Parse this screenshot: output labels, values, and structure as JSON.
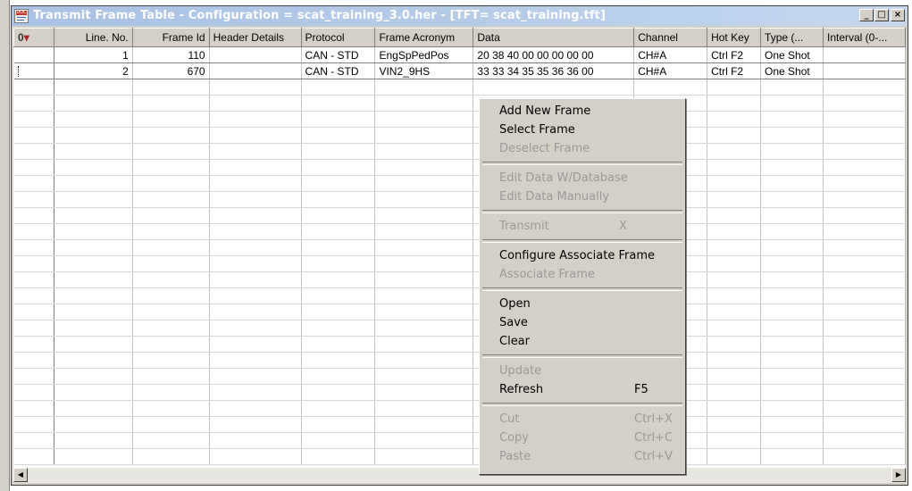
{
  "window": {
    "title": "Transmit Frame Table - Configuration = scat_training_3.0.her - [TFT= scat_training.tft]",
    "icon_label": "DOC",
    "controls": {
      "minimize": "_",
      "maximize": "□",
      "close": "×"
    }
  },
  "table": {
    "columns": [
      "Line. No.",
      "Frame Id",
      "Header Details",
      "Protocol",
      "Frame Acronym",
      "Data",
      "Channel",
      "Hot Key",
      "Type (...",
      "Interval (0-..."
    ],
    "header_icons": {
      "left": "0",
      "right": "▾"
    },
    "rows": [
      {
        "line": "1",
        "frame_id": "110",
        "header": "",
        "protocol": "CAN - STD",
        "acronym": "EngSpPedPos",
        "data": "20 38 40 00 00 00 00 00",
        "channel": "CH#A",
        "hotkey": "Ctrl F2",
        "type": "One Shot",
        "interval": ""
      },
      {
        "line": "2",
        "frame_id": "670",
        "header": "",
        "protocol": "CAN - STD",
        "acronym": "VIN2_9HS",
        "data": "33 33 34 35 35 36 36 00",
        "channel": "CH#A",
        "hotkey": "Ctrl F2",
        "type": "One Shot",
        "interval": ""
      }
    ]
  },
  "context_menu": {
    "add_new_frame": "Add New Frame",
    "select_frame": "Select Frame",
    "deselect_frame": "Deselect Frame",
    "edit_data_db": "Edit Data W/Database",
    "edit_data_manual": "Edit Data Manually",
    "transmit": "Transmit",
    "transmit_shortcut": "X",
    "configure_associate": "Configure Associate Frame",
    "associate_frame": "Associate Frame",
    "open": "Open",
    "save": "Save",
    "clear": "Clear",
    "update": "Update",
    "refresh": "Refresh",
    "refresh_shortcut": "F5",
    "cut": "Cut",
    "cut_shortcut": "Ctrl+X",
    "copy": "Copy",
    "copy_shortcut": "Ctrl+C",
    "paste": "Paste",
    "paste_shortcut": "Ctrl+V"
  },
  "scrollbar": {
    "left_arrow": "◀",
    "right_arrow": "▶"
  }
}
